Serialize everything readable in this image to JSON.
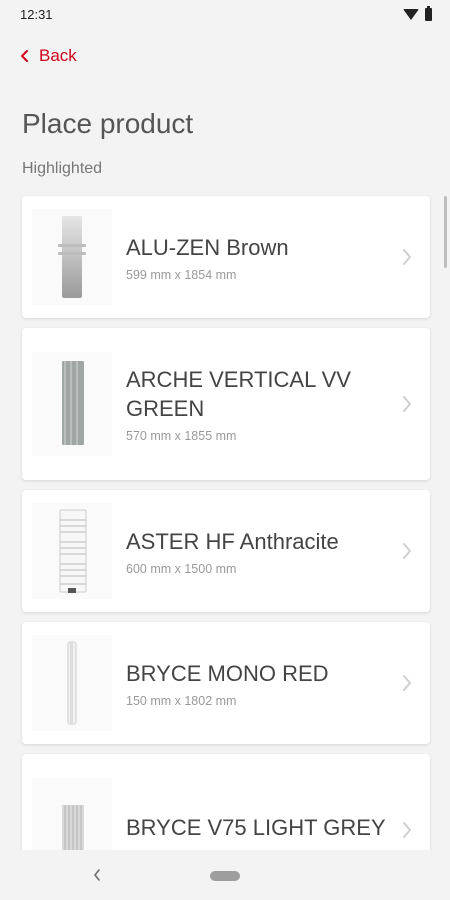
{
  "status_bar": {
    "time": "12:31"
  },
  "nav": {
    "back_label": "Back"
  },
  "page": {
    "title": "Place product",
    "section": "Highlighted"
  },
  "products": [
    {
      "name": "ALU-ZEN Brown",
      "dims": "599 mm x 1854 mm",
      "thumb": "alu-zen"
    },
    {
      "name": "ARCHE VERTICAL VV GREEN",
      "dims": "570 mm x 1855 mm",
      "thumb": "arche"
    },
    {
      "name": "ASTER HF Anthracite",
      "dims": "600 mm x 1500 mm",
      "thumb": "aster"
    },
    {
      "name": "BRYCE MONO RED",
      "dims": "150 mm x 1802 mm",
      "thumb": "bryce-mono"
    },
    {
      "name": "BRYCE V75 LIGHT GREY",
      "dims": "",
      "thumb": "bryce-v75"
    }
  ],
  "colors": {
    "accent": "#d0021b"
  }
}
